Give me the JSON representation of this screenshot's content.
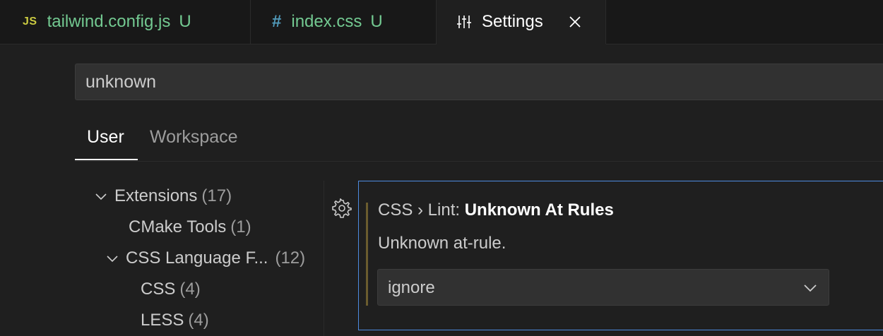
{
  "tabs": [
    {
      "icon_text": "JS",
      "label": "tailwind.config.js",
      "badge": "U"
    },
    {
      "icon_text": "#",
      "label": "index.css",
      "badge": "U"
    },
    {
      "label": "Settings",
      "icon": "settings-sliders-icon",
      "close_icon": "close-icon"
    }
  ],
  "search": {
    "value": "unknown",
    "placeholder": ""
  },
  "scope_tabs": {
    "user": "User",
    "workspace": "Workspace"
  },
  "toc": [
    {
      "label": "Extensions",
      "count": "(17)",
      "expanded": true
    },
    {
      "label": "CMake Tools",
      "count": "(1)"
    },
    {
      "label": "CSS Language F...",
      "count": "(12)",
      "expanded": true
    },
    {
      "label": "CSS",
      "count": "(4)"
    },
    {
      "label": "LESS",
      "count": "(4)"
    }
  ],
  "setting": {
    "category": "CSS › Lint: ",
    "key": "Unknown At Rules",
    "description": "Unknown at-rule.",
    "selected_value": "ignore"
  },
  "colors": {
    "accent_border": "#4d8be0",
    "git_untracked": "#73c991",
    "js_icon": "#cbcb41",
    "css_icon": "#519aba"
  }
}
